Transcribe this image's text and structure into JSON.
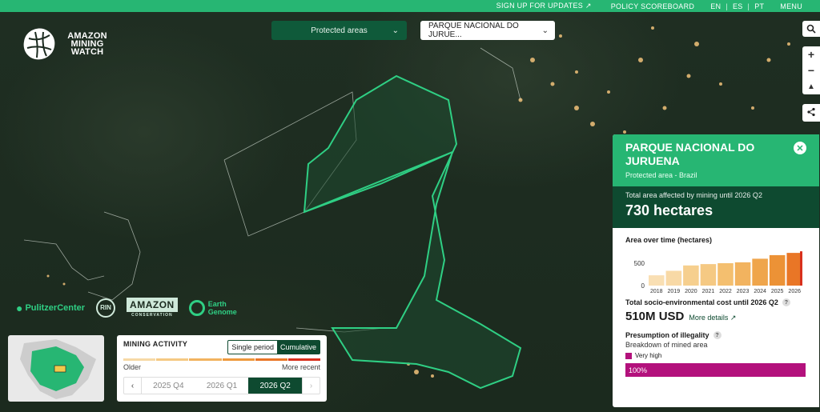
{
  "topbar": {
    "signup": "SIGN UP FOR UPDATES",
    "policy": "POLICY SCOREBOARD",
    "languages": [
      "EN",
      "ES",
      "PT"
    ],
    "menu": "MENU"
  },
  "logo": {
    "line1": "AMAZON",
    "line2": "MINING",
    "line3": "WATCH"
  },
  "filters": {
    "layer": "Protected areas",
    "area": "PARQUE NACIONAL DO JURUE..."
  },
  "panel": {
    "title": "PARQUE NACIONAL DO JURUENA",
    "subtitle": "Protected area - Brazil",
    "area_label": "Total area affected by mining until 2026 Q2",
    "area_value": "730 hectares",
    "chart_label": "Area over time (hectares)",
    "cost_label": "Total socio-environmental cost until 2026 Q2",
    "cost_value": "510M USD",
    "more_details": "More details",
    "illegality_label": "Presumption of illegality",
    "illegality_sub": "Breakdown of mined area",
    "legend_very_high": "Very high",
    "bar_value": "100%"
  },
  "chart_data": {
    "type": "bar",
    "title": "Area over time (hectares)",
    "categories": [
      "2018",
      "2019",
      "2020",
      "2021",
      "2022",
      "2023",
      "2024",
      "2025",
      "2026"
    ],
    "values": [
      230,
      330,
      450,
      480,
      500,
      520,
      600,
      680,
      730
    ],
    "yticks": [
      0,
      500
    ],
    "ylim": [
      0,
      750
    ],
    "xlabel": "",
    "ylabel": ""
  },
  "partners": {
    "pulitzer": "PulitzerCenter",
    "rin": "RIN",
    "amazon": "AMAZON",
    "amazon_sub": "CONSERVATION",
    "earth1": "Earth",
    "earth2": "Genome"
  },
  "mining": {
    "title": "MINING ACTIVITY",
    "single": "Single period",
    "cumulative": "Cumulative",
    "older": "Older",
    "recent": "More recent",
    "periods": [
      "2025 Q4",
      "2026 Q1",
      "2026 Q2"
    ]
  },
  "colors": {
    "brand": "#27b673",
    "dark": "#0e4a30",
    "illegal": "#b3117c"
  }
}
